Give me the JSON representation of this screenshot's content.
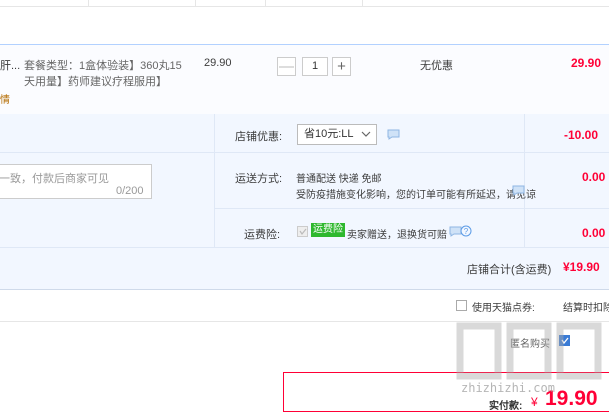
{
  "item": {
    "name_fragment": "肝...",
    "name_sub_fragment": "情",
    "spec_line1": "套餐类型：1盒体验装】360丸15",
    "spec_line2": "天用量】药师建议疗程服用】",
    "unit_price": "29.90",
    "quantity": "1",
    "minus_label": "—",
    "plus_label": "+",
    "discount": "无优惠",
    "subtotal": "29.90"
  },
  "shop": {
    "coupon_label": "店铺优惠:",
    "coupon_selected": "省10元:LL",
    "coupon_amount": "-10.00",
    "message_placeholder": "一致，付款后商家可见",
    "message_counter": "0/200",
    "shipping_label": "运送方式:",
    "shipping_value": "普通配送 快递 免邮",
    "shipping_notice": "受防疫措施变化影响，您的订单可能有所延迟，请见谅",
    "shipping_amount": "0.00",
    "insurance_label": "运费险:",
    "insurance_tag": "运费险",
    "insurance_text": "卖家赠送，退换货可赔",
    "insurance_amount": "0.00",
    "total_label": "店铺合计(含运费)",
    "total_value": "¥19.90"
  },
  "points": {
    "label": "使用天猫点券:",
    "settlement_text": "结算时扣除"
  },
  "anonymous": {
    "label": "匿名购买"
  },
  "payment": {
    "label": "实付款:",
    "currency": "¥",
    "amount": "19.90"
  },
  "watermark": {
    "text": "zhizhizhi.com"
  },
  "colors": {
    "accent_red": "#ff0036",
    "row_blue": "#b2d1ff",
    "shop_bg": "#f2f7ff",
    "insurance_green": "#2eb82e"
  }
}
